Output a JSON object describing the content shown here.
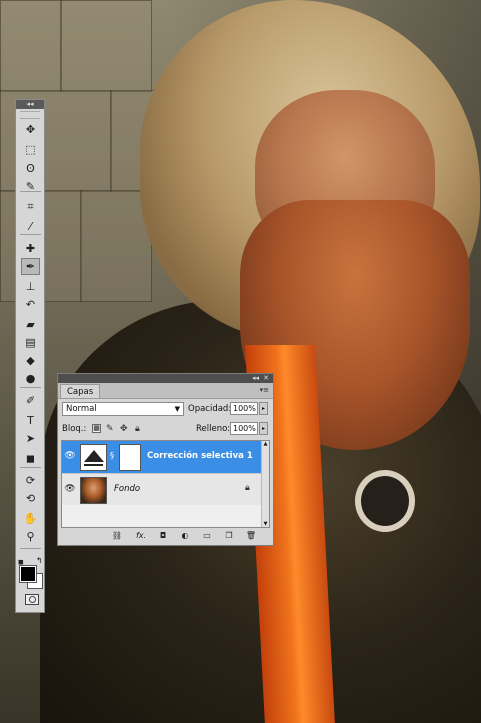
{
  "tools_panel": {
    "collapse_glyph": "◂◂",
    "tools": [
      {
        "name": "move-tool-icon",
        "glyph": "✥"
      },
      {
        "name": "marquee-tool-icon",
        "glyph": "⬚"
      },
      {
        "name": "lasso-tool-icon",
        "glyph": "ʘ"
      },
      {
        "name": "quick-selection-tool-icon",
        "glyph": "✎"
      },
      {
        "name": "crop-tool-icon",
        "glyph": "⌗"
      },
      {
        "name": "eyedropper-tool-icon",
        "glyph": "⁄"
      },
      {
        "name": "healing-brush-tool-icon",
        "glyph": "✚"
      },
      {
        "name": "brush-tool-icon",
        "glyph": "✒"
      },
      {
        "name": "clone-stamp-tool-icon",
        "glyph": "⊥"
      },
      {
        "name": "history-brush-tool-icon",
        "glyph": "↶"
      },
      {
        "name": "eraser-tool-icon",
        "glyph": "▰"
      },
      {
        "name": "gradient-tool-icon",
        "glyph": "▤"
      },
      {
        "name": "blur-tool-icon",
        "glyph": "◆"
      },
      {
        "name": "dodge-tool-icon",
        "glyph": "●"
      },
      {
        "name": "pen-tool-icon",
        "glyph": "✐"
      },
      {
        "name": "type-tool-icon",
        "glyph": "T"
      },
      {
        "name": "path-selection-tool-icon",
        "glyph": "➤"
      },
      {
        "name": "shape-tool-icon",
        "glyph": "◼"
      },
      {
        "name": "3d-rotate-tool-icon",
        "glyph": "⟳"
      },
      {
        "name": "3d-orbit-tool-icon",
        "glyph": "⟲"
      },
      {
        "name": "hand-tool-icon",
        "glyph": "✋"
      },
      {
        "name": "zoom-tool-icon",
        "glyph": "⚲"
      }
    ],
    "active_tool": "brush-tool-icon",
    "foreground_color": "#000000",
    "background_color": "#ffffff"
  },
  "layers_panel": {
    "collapse_glyph": "◂◂",
    "tab_label": "Capas",
    "blend_mode": "Normal",
    "opacity_label": "Opacidad:",
    "opacity_value": "100%",
    "lock_label": "Bloq.:",
    "fill_label": "Relleno:",
    "fill_value": "100%",
    "layers": [
      {
        "name": "Corrección selectiva 1",
        "type": "adjustment",
        "selected": true,
        "visible": true
      },
      {
        "name": "Fondo",
        "type": "background",
        "selected": false,
        "visible": true,
        "locked": true
      }
    ],
    "footer_icons": [
      "link-layers-icon",
      "fx-icon",
      "add-mask-icon",
      "new-adjustment-layer-icon",
      "new-group-icon",
      "new-layer-icon",
      "delete-layer-icon"
    ],
    "fx_label": "fx.",
    "selection_color": "#3a8ee6"
  }
}
